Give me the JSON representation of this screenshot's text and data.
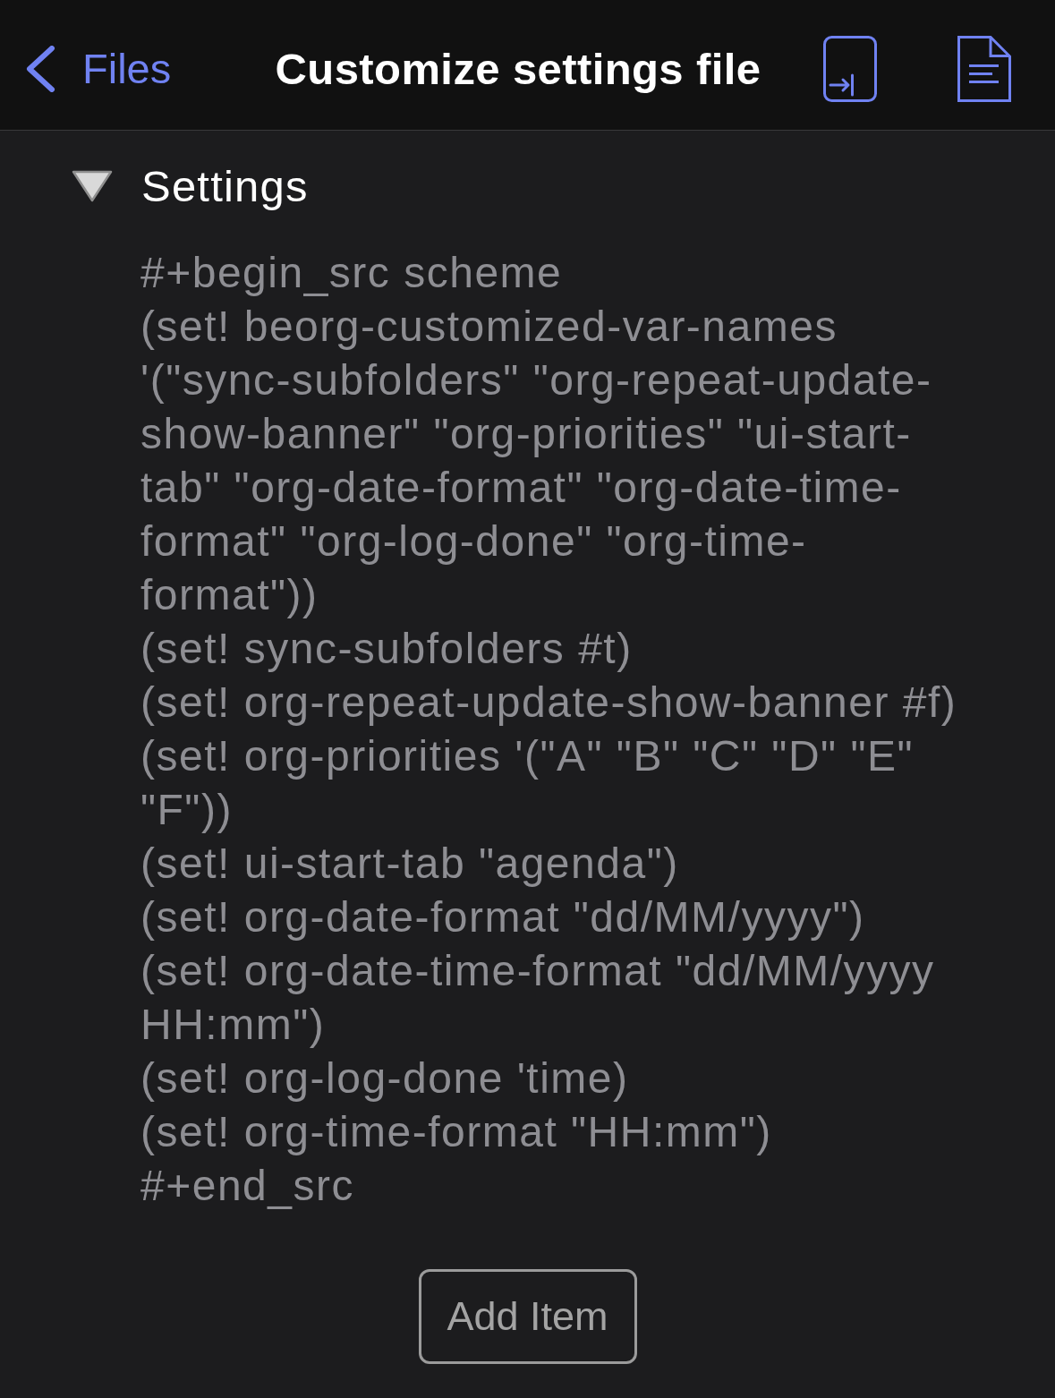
{
  "nav_bar": {
    "back_label": "Files",
    "title": "Customize settings file"
  },
  "section": {
    "title": "Settings",
    "expanded": true,
    "code_lines": [
      "#+begin_src scheme",
      "(set! beorg-customized-var-names",
      "'(\"sync-subfolders\" \"org-repeat-update-",
      "show-banner\" \"org-priorities\" \"ui-start-",
      "tab\" \"org-date-format\" \"org-date-time-",
      "format\" \"org-log-done\" \"org-time-",
      "format\"))",
      "(set! sync-subfolders #t)",
      "(set! org-repeat-update-show-banner #f)",
      "(set! org-priorities '(\"A\" \"B\" \"C\" \"D\" \"E\"",
      "\"F\"))",
      "(set! ui-start-tab \"agenda\")",
      "(set! org-date-format \"dd/MM/yyyy\")",
      "(set! org-date-time-format \"dd/MM/yyyy",
      "HH:mm\")",
      "(set! org-log-done 'time)",
      "(set! org-time-format \"HH:mm\")",
      "#+end_src"
    ]
  },
  "add_button": {
    "label": "Add Item"
  }
}
